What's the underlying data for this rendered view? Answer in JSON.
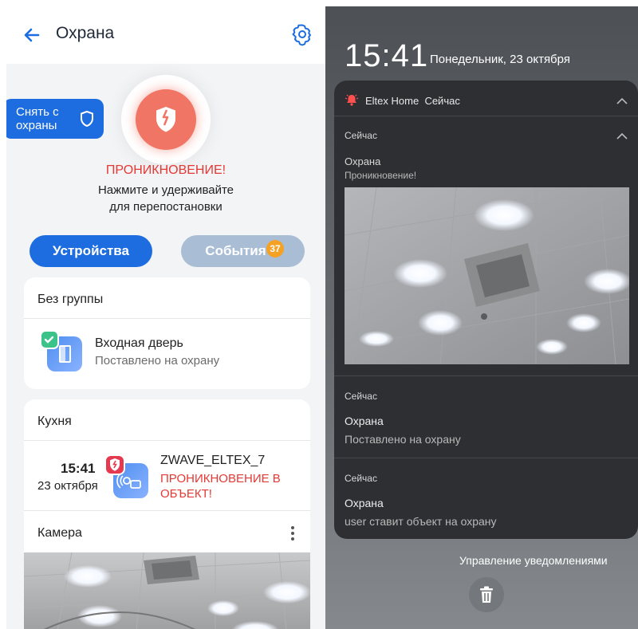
{
  "app": {
    "title": "Охрана",
    "disarm_label": "Снять с охраны",
    "status": "ПРОНИКНОВЕНИЕ!",
    "hint": "Нажмите и удерживайте для перепостановки",
    "tabs": [
      {
        "label": "Устройства",
        "active": true
      },
      {
        "label": "События",
        "badge": "37",
        "active": false
      }
    ],
    "groups": [
      {
        "name": "Без группы",
        "devices": [
          {
            "name": "Входная дверь",
            "status": "Поставлено на охрану",
            "badge": "armed"
          }
        ]
      },
      {
        "name": "Кухня",
        "devices": [
          {
            "time": "15:41",
            "date": "23 октября",
            "name": "ZWAVE_ELTEX_7",
            "status": "ПРОНИКНОВЕНИЕ В ОБЪЕКТ!",
            "badge": "alarm"
          }
        ]
      }
    ],
    "camera_label": "Камера",
    "colors": {
      "primary": "#1d6de0",
      "alarm": "#e53935",
      "badge": "#f5a124",
      "armed": "#3cc38a"
    }
  },
  "lockscreen": {
    "time": "15:41",
    "date": "Понедельник, 23 октября",
    "app_name": "Eltex Home",
    "app_time": "Сейчас",
    "notifications": [
      {
        "when": "Сейчас",
        "title": "Охрана",
        "body": "Проникновение!",
        "has_image": true
      },
      {
        "when": "Сейчас",
        "title": "Охрана",
        "body": "Поставлено на охрану"
      },
      {
        "when": "Сейчас",
        "title": "Охрана",
        "body": "user ставит объект на охрану"
      }
    ],
    "manage_label": "Управление уведомлениями"
  }
}
